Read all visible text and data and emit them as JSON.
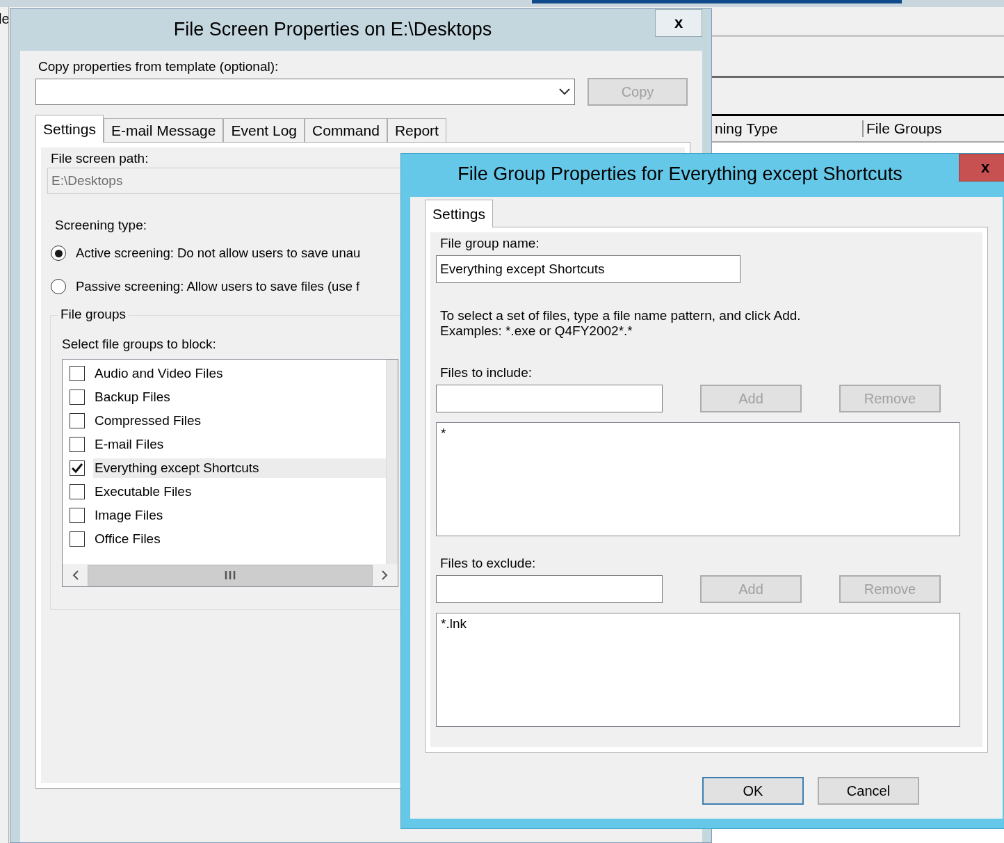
{
  "background_app": {
    "menu_fragment": "le",
    "columns": [
      "ning Type",
      "File Groups"
    ]
  },
  "file_screen_dialog": {
    "title": "File Screen Properties on E:\\Desktops",
    "close": "x",
    "template_label": "Copy properties from template (optional):",
    "copy_button": {
      "label": "Copy",
      "disabled": true
    },
    "tabs": [
      {
        "label": "Settings",
        "selected": true
      },
      {
        "label": "E-mail Message",
        "selected": false
      },
      {
        "label": "Event Log",
        "selected": false
      },
      {
        "label": "Command",
        "selected": false
      },
      {
        "label": "Report",
        "selected": false
      }
    ],
    "path_label": "File screen path:",
    "path_value": "E:\\Desktops",
    "screening_label": "Screening type:",
    "screening_options": [
      {
        "label": "Active screening: Do not allow users to save unau",
        "selected": true
      },
      {
        "label": "Passive screening: Allow users to save files (use f",
        "selected": false
      }
    ],
    "file_groups_legend": "File groups",
    "file_groups_prompt": "Select file groups to block:",
    "file_groups": [
      {
        "label": "Audio and Video Files",
        "checked": false,
        "selected": false
      },
      {
        "label": "Backup Files",
        "checked": false,
        "selected": false
      },
      {
        "label": "Compressed Files",
        "checked": false,
        "selected": false
      },
      {
        "label": "E-mail Files",
        "checked": false,
        "selected": false
      },
      {
        "label": "Everything except Shortcuts",
        "checked": true,
        "selected": true
      },
      {
        "label": "Executable Files",
        "checked": false,
        "selected": false
      },
      {
        "label": "Image Files",
        "checked": false,
        "selected": false
      },
      {
        "label": "Office Files",
        "checked": false,
        "selected": false
      }
    ]
  },
  "file_group_dialog": {
    "title": "File Group Properties for Everything except Shortcuts",
    "close": "x",
    "tabs": [
      {
        "label": "Settings",
        "selected": true
      }
    ],
    "name_label": "File group name:",
    "name_value": "Everything except Shortcuts",
    "instructions": [
      "To select a set of files, type a file name pattern, and click Add.",
      "Examples: *.exe or Q4FY2002*.*"
    ],
    "include": {
      "label": "Files to include:",
      "add": {
        "label": "Add",
        "disabled": true
      },
      "remove": {
        "label": "Remove",
        "disabled": true
      },
      "items": [
        "*"
      ]
    },
    "exclude": {
      "label": "Files to exclude:",
      "add": {
        "label": "Add",
        "disabled": true
      },
      "remove": {
        "label": "Remove",
        "disabled": true
      },
      "items": [
        "*.lnk"
      ]
    },
    "buttons": [
      {
        "label": "OK",
        "default": true
      },
      {
        "label": "Cancel",
        "default": false
      }
    ]
  }
}
